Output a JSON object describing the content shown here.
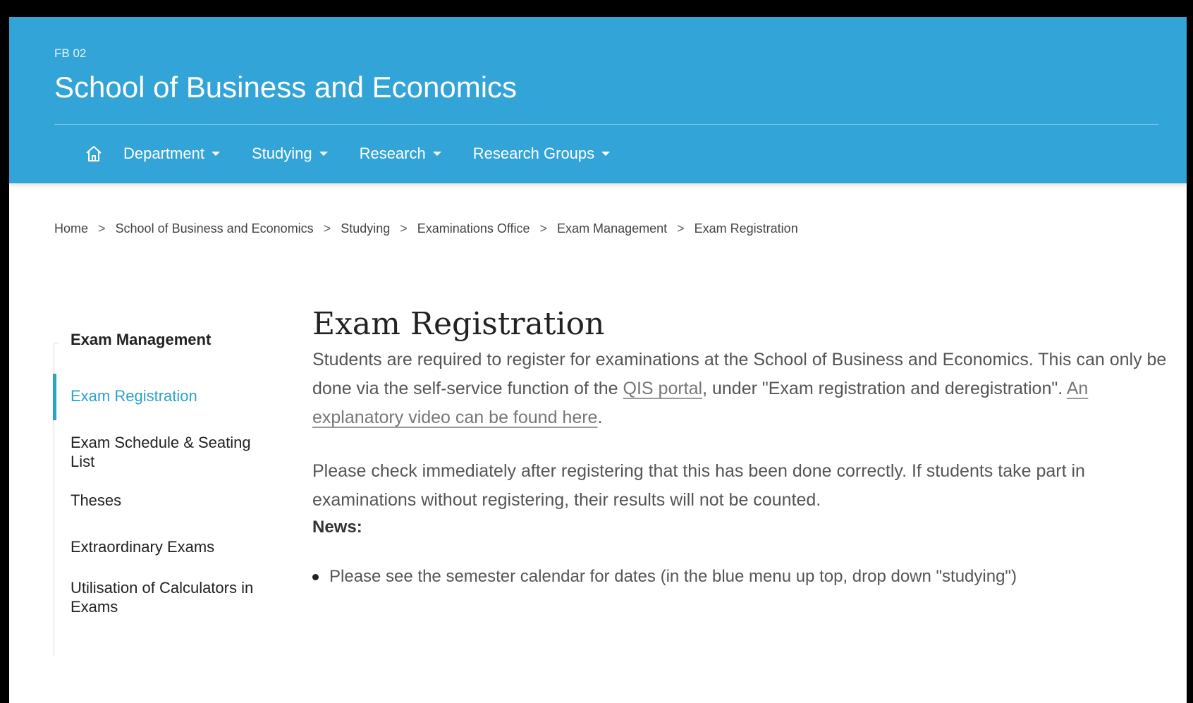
{
  "header": {
    "faculty_code": "FB 02",
    "title": "School of Business and Economics",
    "color": "#33a4d7"
  },
  "nav": {
    "home_icon": "home-icon",
    "items": [
      {
        "label": "Department"
      },
      {
        "label": "Studying"
      },
      {
        "label": "Research"
      },
      {
        "label": "Research Groups"
      }
    ]
  },
  "breadcrumb": {
    "separator": ">",
    "items": [
      {
        "label": "Home"
      },
      {
        "label": "School of Business and Economics"
      },
      {
        "label": "Studying"
      },
      {
        "label": "Examinations Office"
      },
      {
        "label": "Exam Management"
      },
      {
        "label": "Exam Registration"
      }
    ]
  },
  "sidebar": {
    "heading": "Exam Management",
    "items": [
      {
        "label": "Exam Registration",
        "active": true
      },
      {
        "label": "Exam Schedule & Seating List"
      },
      {
        "label": "Theses"
      },
      {
        "label": "Extraordinary Exams"
      },
      {
        "label": "Utilisation of Calculators in Exams"
      }
    ],
    "accent_color": "#2aa3c8"
  },
  "main": {
    "title": "Exam Registration",
    "p1_before_link": "Students are required to register for examinations at the School of Business and Economics. This can only be done via the self-service function of the ",
    "p1_link1": "QIS portal",
    "p1_middle": ", under \"Exam registration and deregistration\". ",
    "p1_link2": "An explanatory video can be found here",
    "p1_end": ".",
    "p2": "Please check immediately after registering that this has been done correctly. If students take part in examinations without registering, their results will not be counted.",
    "news_heading": "News:",
    "news_items": [
      "Please see the semester calendar for dates (in the blue menu up top, drop down \"studying\")"
    ]
  }
}
